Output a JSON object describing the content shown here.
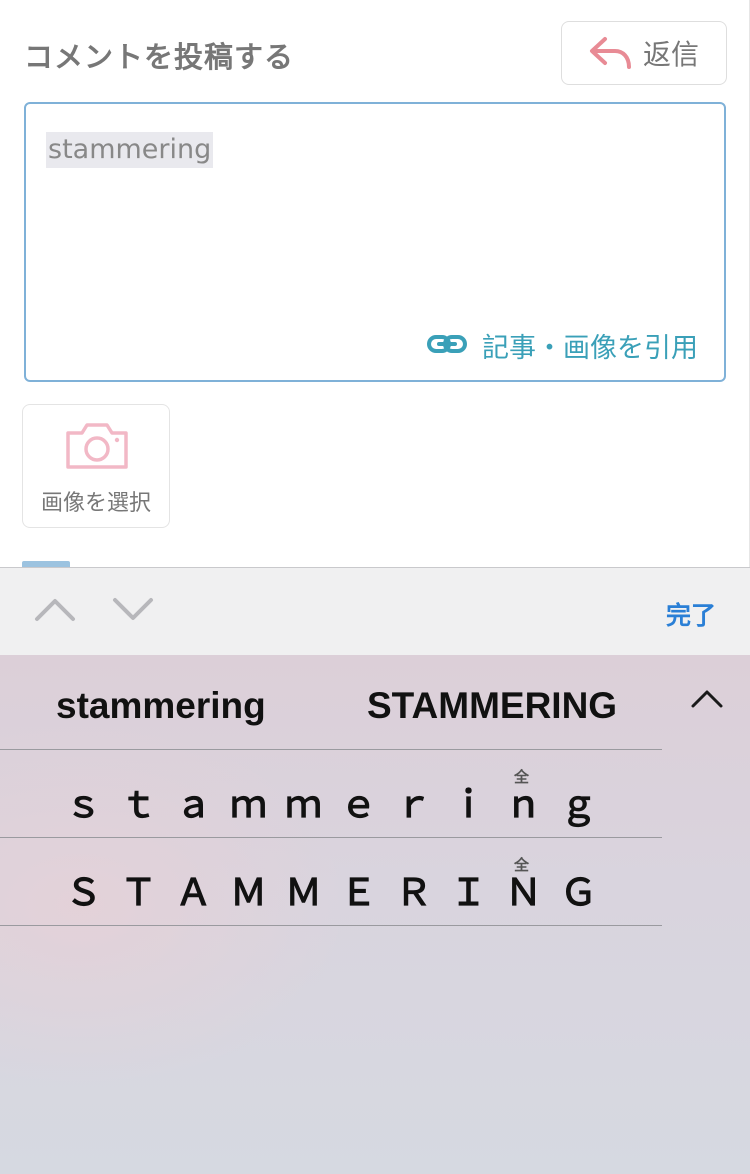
{
  "form": {
    "title": "コメントを投稿する",
    "reply_label": "返信",
    "comment_text": "stammering",
    "quote_label": "記事・画像を引用",
    "image_select_label": "画像を選択"
  },
  "accessory_bar": {
    "done_label": "完了"
  },
  "candidates": {
    "row1": [
      "stammering",
      "STAMMERING"
    ],
    "row2": {
      "text": "ｓｔａｍｍｅｒｉｎｇ",
      "badge": "全"
    },
    "row3": {
      "text": "ＳＴＡＭＭＥＲＩＮＧ",
      "badge": "全"
    }
  },
  "colors": {
    "accent_blue": "#2a7fd6",
    "link_teal": "#3aa0b8",
    "reply_icon_pink": "#e88b95",
    "camera_icon_pink": "#f2b8c6",
    "input_border": "#7fb1d8"
  },
  "icons": {
    "reply": "reply-arrow-icon",
    "link": "link-icon",
    "camera": "camera-icon",
    "prev": "chevron-up-icon",
    "next": "chevron-down-icon",
    "expand": "chevron-up-icon"
  }
}
